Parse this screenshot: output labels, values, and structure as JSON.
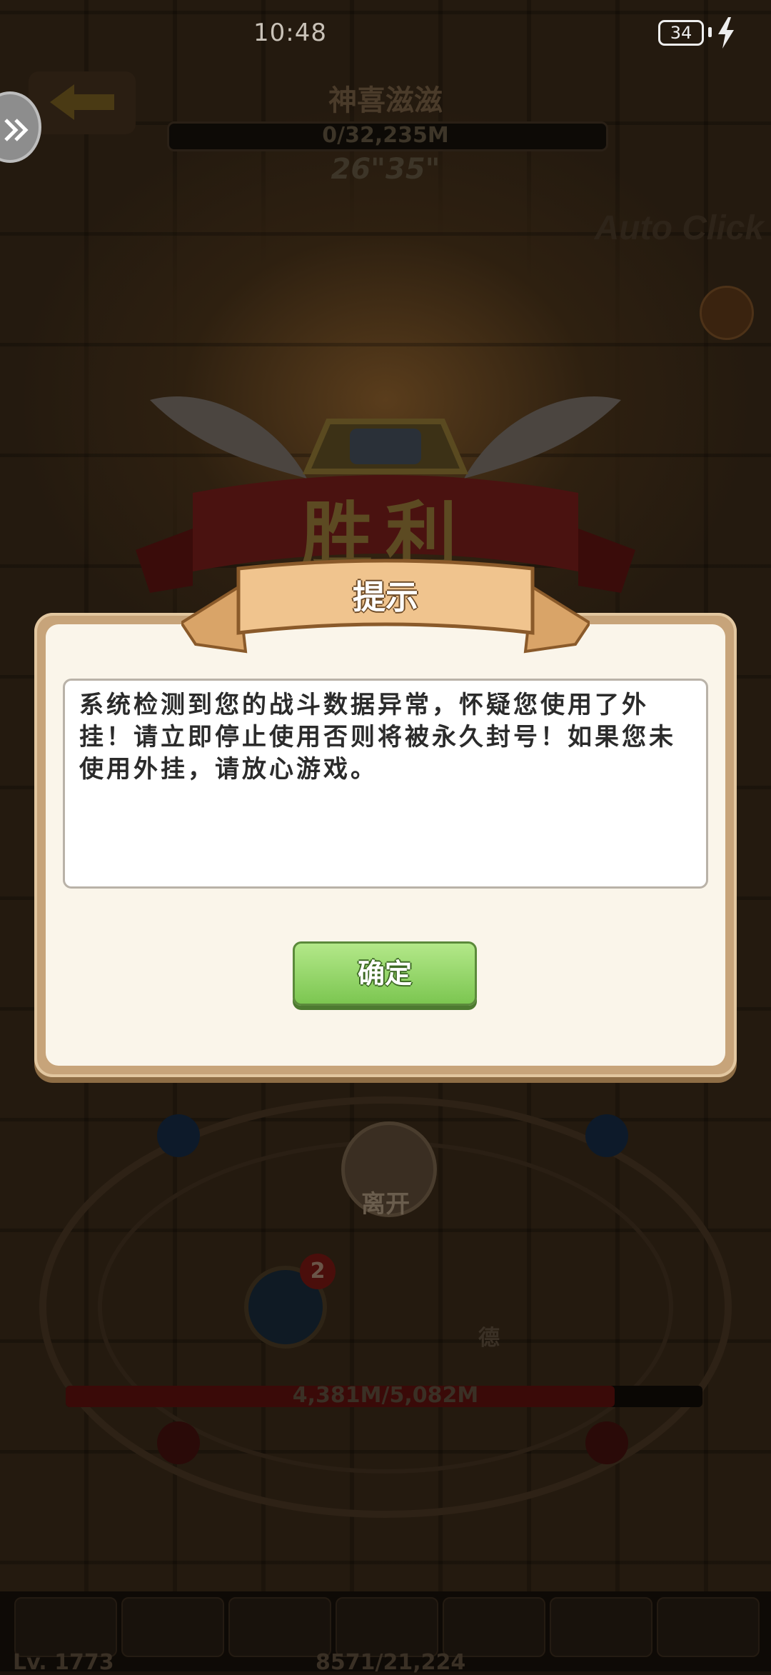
{
  "status_bar": {
    "time": "10:48",
    "battery": "34"
  },
  "battle": {
    "boss_name": "神喜滋滋",
    "boss_hp": "0/32,235M",
    "timer": "26\"35\"",
    "auto_click": "Auto Click",
    "victory": "胜利",
    "leave": "离开",
    "player_hp": "4,381M/5,082M",
    "daily_badge": "2",
    "daily_label": "德",
    "level": "Lv. 1773",
    "exp": "8571/21,224"
  },
  "dialog": {
    "title": "提示",
    "message": "系统检测到您的战斗数据异常，怀疑您使用了外挂！请立即停止使用否则将被永久封号！如果您未使用外挂，请放心游戏。",
    "confirm_label": "确定"
  },
  "colors": {
    "confirm_green": "#7cc651",
    "dialog_frame": "#c7a47a",
    "ribbon": "#e8b57c"
  }
}
